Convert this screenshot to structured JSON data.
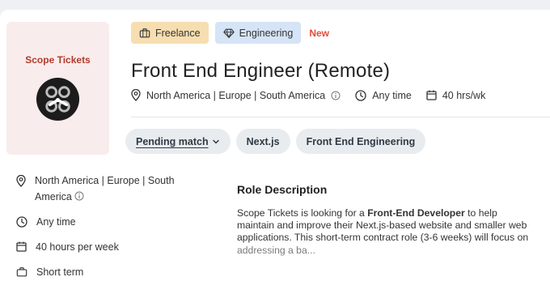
{
  "company": {
    "name": "Scope Tickets"
  },
  "badges": {
    "type_label": "Freelance",
    "category_label": "Engineering",
    "new_label": "New"
  },
  "job": {
    "title": "Front End Engineer (Remote)",
    "location": "North America | Europe | South America",
    "schedule": "Any time",
    "hours": "40 hrs/wk"
  },
  "pills": {
    "status": "Pending match",
    "skill_1": "Next.js",
    "skill_2": "Front End Engineering"
  },
  "details": {
    "location_line1": "North America | Europe | South",
    "location_line2": "America",
    "schedule": "Any time",
    "hours": "40 hours per week",
    "duration": "Short term"
  },
  "role": {
    "heading": "Role Description",
    "desc_part1": "Scope Tickets is looking for a ",
    "desc_bold": "Front-End Developer",
    "desc_part2": " to help maintain and improve their Next.js-based website and smaller web applications. This short-term contract role (3-6 weeks) will focus on ",
    "desc_fade": "addressing a ba..."
  },
  "colors": {
    "accent_red": "#e44b3c",
    "company_red": "#b23a2c",
    "freelance_bg": "#f7deb0",
    "engineering_bg": "#d6e4f7"
  },
  "icons": [
    "briefcase-icon",
    "diamond-icon",
    "location-pin-icon",
    "info-icon",
    "clock-icon",
    "calendar-icon",
    "chevron-down-icon"
  ]
}
